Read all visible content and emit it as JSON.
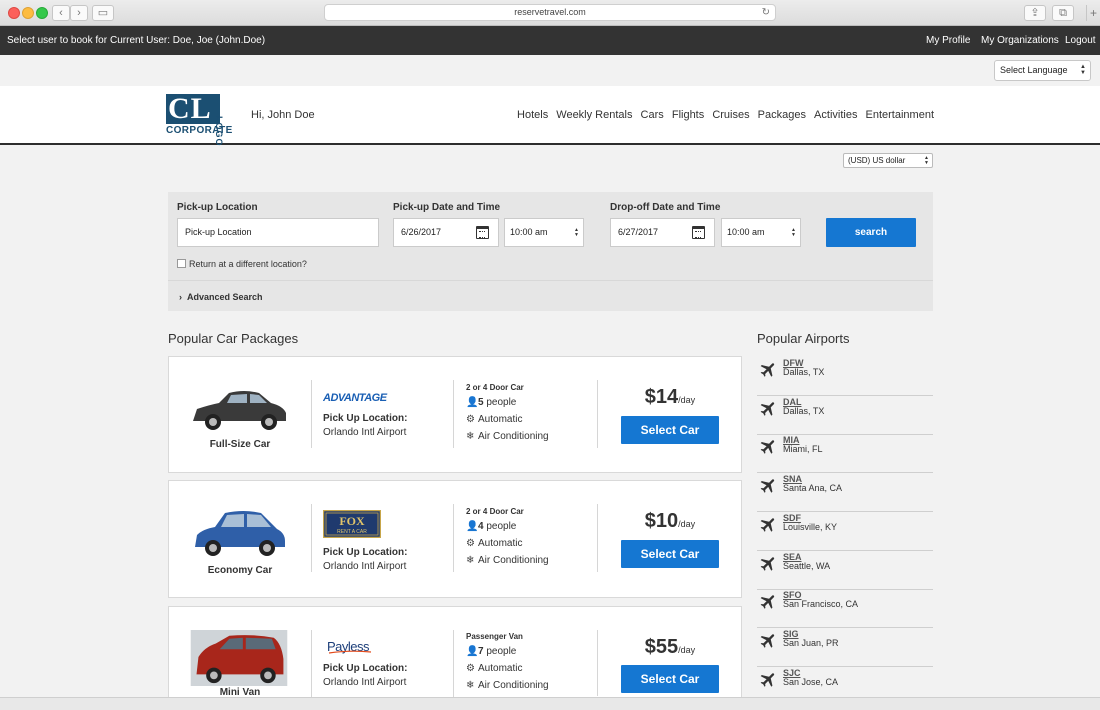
{
  "browser": {
    "url": "reservetravel.com"
  },
  "topbar": {
    "select_user": "Select user to book for",
    "current_user": "Current User: Doe, Joe (John.Doe)",
    "my_profile": "My Profile",
    "my_organizations": "My Organizations",
    "logout": "Logout"
  },
  "language": {
    "selected": "Select Language"
  },
  "header": {
    "logo_main": "CL",
    "logo_sub": "CORPORATE",
    "logo_side": "LOGO",
    "greeting": "Hi, John Doe",
    "nav": [
      "Hotels",
      "Weekly Rentals",
      "Cars",
      "Flights",
      "Cruises",
      "Packages",
      "Activities",
      "Entertainment"
    ]
  },
  "currency": {
    "selected": "(USD) US dollar"
  },
  "search": {
    "pickup_location_label": "Pick-up Location",
    "pickup_location_value": "Pick-up Location",
    "pickup_dt_label": "Pick-up Date and Time",
    "pickup_date": "6/26/2017",
    "pickup_time": "10:00 am",
    "dropoff_dt_label": "Drop-off Date and Time",
    "dropoff_date": "6/27/2017",
    "dropoff_time": "10:00 am",
    "search_button": "search",
    "return_different": "Return at a different location?",
    "advanced": "Advanced Search"
  },
  "packages": {
    "title": "Popular Car Packages",
    "pickup_label": "Pick Up Location:",
    "select_label": "Select Car",
    "items": [
      {
        "car_name": "Full-Size Car",
        "vendor": "ADVANTAGE",
        "location": "Orlando Intl Airport",
        "car_type": "2 or 4 Door Car",
        "people_num": "5",
        "people_word": "people",
        "transmission": "Automatic",
        "ac": "Air Conditioning",
        "price": "$14",
        "per": "/day",
        "color": "#3a3a3a"
      },
      {
        "car_name": "Economy Car",
        "vendor": "FOX",
        "location": "Orlando Intl Airport",
        "car_type": "2 or 4 Door Car",
        "people_num": "4",
        "people_word": "people",
        "transmission": "Automatic",
        "ac": "Air Conditioning",
        "price": "$10",
        "per": "/day",
        "color": "#2f5fa8"
      },
      {
        "car_name": "Mini Van",
        "vendor": "Payless",
        "location": "Orlando Intl Airport",
        "car_type": "Passenger Van",
        "people_num": "7",
        "people_word": "people",
        "transmission": "Automatic",
        "ac": "Air Conditioning",
        "price": "$55",
        "per": "/day",
        "color": "#a8261b"
      }
    ]
  },
  "airports": {
    "title": "Popular Airports",
    "items": [
      {
        "code": "DFW",
        "city": "Dallas, TX"
      },
      {
        "code": "DAL",
        "city": "Dallas, TX"
      },
      {
        "code": "MIA",
        "city": "Miami, FL"
      },
      {
        "code": "SNA",
        "city": "Santa Ana, CA"
      },
      {
        "code": "SDF",
        "city": "Louisville, KY"
      },
      {
        "code": "SEA",
        "city": "Seattle, WA"
      },
      {
        "code": "SFO",
        "city": "San Francisco, CA"
      },
      {
        "code": "SIG",
        "city": "San Juan, PR"
      },
      {
        "code": "SJC",
        "city": "San Jose, CA"
      }
    ]
  },
  "icons": {
    "plane": "airplane-icon",
    "person": "person-icon",
    "gear": "transmission-icon",
    "snow": "snowflake-icon",
    "calendar": "calendar-icon"
  }
}
